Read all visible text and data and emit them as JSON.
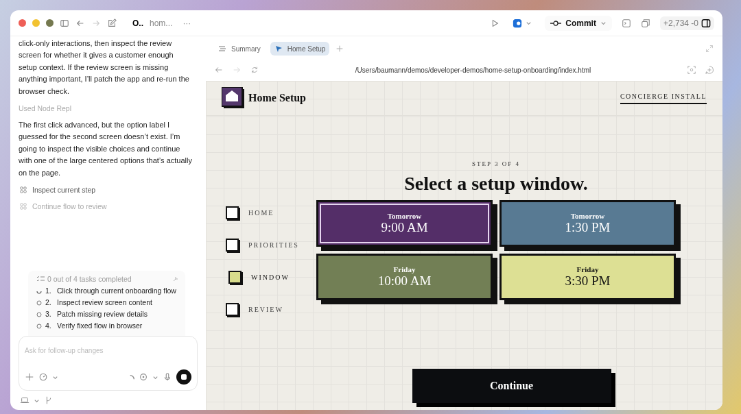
{
  "window": {
    "title_bold": "O..",
    "title_rest": "hom...",
    "more": "···"
  },
  "toolbar": {
    "commit": "Commit",
    "diff": "+2,734 -0"
  },
  "chat": {
    "paragraphs": [
      {
        "kind": "message",
        "text": "click-only interactions, then inspect the review screen for whether it gives a customer enough setup context. If the review screen is missing anything important, I’ll patch the app and re-run the browser check."
      },
      {
        "kind": "note",
        "text": "Used Node Repl"
      },
      {
        "kind": "message",
        "text": "The first click advanced, but the option label I guessed for the second screen doesn’t exist. I’m going to inspect the visible choices and continue with one of the large centered options that’s actually on the page."
      }
    ],
    "steps": [
      {
        "label": "Inspect current step",
        "dimmed": false
      },
      {
        "label": "Continue flow to review",
        "dimmed": true
      }
    ],
    "tasks": {
      "summary": "0 out of 4 tasks completed",
      "items": [
        {
          "number": "1.",
          "label": "Click through current onboarding flow",
          "in_progress": true
        },
        {
          "number": "2.",
          "label": "Inspect review screen content",
          "in_progress": false
        },
        {
          "number": "3.",
          "label": "Patch missing review details",
          "in_progress": false
        },
        {
          "number": "4.",
          "label": "Verify fixed flow in browser",
          "in_progress": false
        }
      ]
    },
    "composer": {
      "placeholder": "Ask for follow-up changes"
    }
  },
  "browser": {
    "tabs": [
      {
        "label": "Summary",
        "selected": false
      },
      {
        "label": "Home Setup",
        "selected": true
      }
    ],
    "url": "/Users/baumann/demos/developer-demos/home-setup-onboarding/index.html"
  },
  "page": {
    "brand": "Home Setup",
    "header_link": "CONCIERGE INSTALL",
    "step_label": "STEP 3 OF 4",
    "heading": "Select a setup window.",
    "steps": [
      {
        "label": "HOME",
        "selected": false
      },
      {
        "label": "PRIORITIES",
        "selected": false
      },
      {
        "label": "WINDOW",
        "selected": true
      },
      {
        "label": "REVIEW",
        "selected": false
      }
    ],
    "options": [
      {
        "day": "Tomorrow",
        "time": "9:00 AM",
        "color": "#542e68",
        "selected": true
      },
      {
        "day": "Tomorrow",
        "time": "1:30 PM",
        "color": "#587a93",
        "selected": false
      },
      {
        "day": "Friday",
        "time": "10:00 AM",
        "color": "#727f55",
        "selected": false
      },
      {
        "day": "Friday",
        "time": "3:30 PM",
        "color": "#dde094",
        "selected": false
      }
    ],
    "continue": "Continue"
  }
}
